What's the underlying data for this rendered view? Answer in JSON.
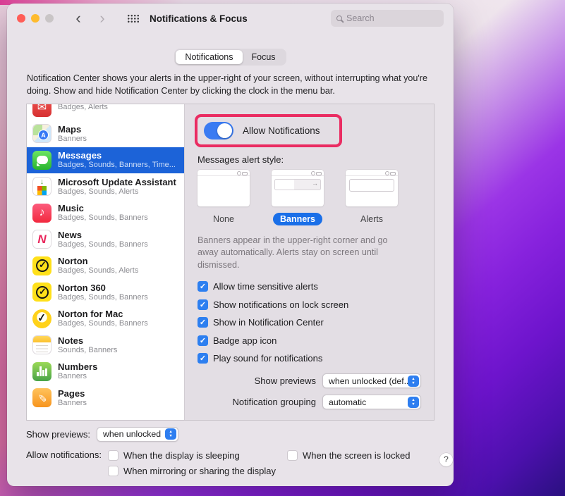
{
  "colors": {
    "accent_blue": "#2d7ff0",
    "selected_row_blue": "#1c63d8",
    "annotation_highlight_pink": "#ea2c62",
    "window_background": "#e8e3e9"
  },
  "titlebar": {
    "title": "Notifications & Focus",
    "back_glyph": "‹",
    "forward_glyph": "›",
    "search_placeholder": "Search"
  },
  "tabs": [
    {
      "label": "Notifications",
      "selected": true
    },
    {
      "label": "Focus"
    }
  ],
  "description": "Notification Center shows your alerts in the upper-right of your screen, without interrupting what you're doing. Show and hide Notification Center by clicking the clock in the menu bar.",
  "sidebar": {
    "items": [
      {
        "name": "",
        "details": "Badges, Alerts",
        "icon": "mail-icon",
        "partial": true
      },
      {
        "name": "Maps",
        "details": "Banners",
        "icon": "maps-icon"
      },
      {
        "name": "Messages",
        "details": "Badges, Sounds, Banners, Time...",
        "icon": "messages-icon",
        "selected": true
      },
      {
        "name": "Microsoft Update Assistant",
        "details": "Badges, Sounds, Alerts",
        "icon": "msupdate-icon"
      },
      {
        "name": "Music",
        "details": "Badges, Sounds, Banners",
        "icon": "music-icon"
      },
      {
        "name": "News",
        "details": "Badges, Sounds, Banners",
        "icon": "news-icon"
      },
      {
        "name": "Norton",
        "details": "Badges, Sounds, Alerts",
        "icon": "norton-icon"
      },
      {
        "name": "Norton 360",
        "details": "Badges, Sounds, Banners",
        "icon": "norton-icon"
      },
      {
        "name": "Norton for Mac",
        "details": "Badges, Sounds, Banners",
        "icon": "norton-mac-icon"
      },
      {
        "name": "Notes",
        "details": "Sounds, Banners",
        "icon": "notes-icon"
      },
      {
        "name": "Numbers",
        "details": "Banners",
        "icon": "numbers-icon"
      },
      {
        "name": "Pages",
        "details": "Banners",
        "icon": "pages-icon"
      }
    ]
  },
  "detail": {
    "allow_notifications_label": "Allow Notifications",
    "toggle_state": "on",
    "alert_style_label": "Messages alert style:",
    "alert_styles": [
      {
        "label": "None",
        "kind": "none"
      },
      {
        "label": "Banners",
        "kind": "banners",
        "selected": true
      },
      {
        "label": "Alerts",
        "kind": "alerts"
      }
    ],
    "alert_style_description": "Banners appear in the upper-right corner and go away automatically. Alerts stay on screen until dismissed.",
    "checkboxes": [
      {
        "label": "Allow time sensitive alerts",
        "checked": true
      },
      {
        "label": "Show notifications on lock screen",
        "checked": true
      },
      {
        "label": "Show in Notification Center",
        "checked": true
      },
      {
        "label": "Badge app icon",
        "checked": true
      },
      {
        "label": "Play sound for notifications",
        "checked": true
      }
    ],
    "show_previews_label": "Show previews",
    "show_previews_value": "when unlocked (def...",
    "grouping_label": "Notification grouping",
    "grouping_value": "automatic"
  },
  "footer": {
    "show_previews_label": "Show previews:",
    "show_previews_value": "when unlocked",
    "allow_notifications_label": "Allow notifications:",
    "options": [
      {
        "label": "When the display is sleeping",
        "checked": false
      },
      {
        "label": "When the screen is locked",
        "checked": false
      },
      {
        "label": "When mirroring or sharing the display",
        "checked": false
      }
    ],
    "help_label": "?"
  }
}
